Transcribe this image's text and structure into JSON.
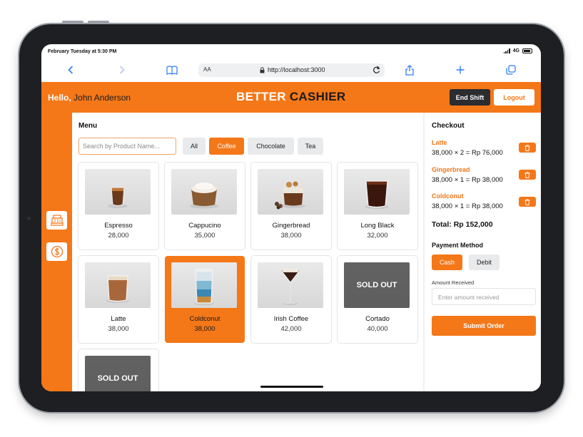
{
  "status_bar": {
    "time": "February Tuesday at 5:30 PM",
    "network": "4G"
  },
  "browser": {
    "url": "http://localhost:3000",
    "text_size_label": "AA"
  },
  "header": {
    "greeting": "Hello,",
    "user_name": "John Anderson",
    "brand_first": "BETTER",
    "brand_second": "CASHIER",
    "end_shift_label": "End Shift",
    "logout_label": "Logout"
  },
  "sidebar": {
    "items": [
      {
        "icon": "cash-register-icon"
      },
      {
        "icon": "dollar-coin-icon"
      }
    ]
  },
  "menu": {
    "title": "Menu",
    "search_placeholder": "Search by Product Name...",
    "filters": [
      {
        "label": "All",
        "active": false
      },
      {
        "label": "Coffee",
        "active": true
      },
      {
        "label": "Chocolate",
        "active": false
      },
      {
        "label": "Tea",
        "active": false
      }
    ],
    "products": [
      {
        "name": "Espresso",
        "price": "28,000",
        "selected": false,
        "sold_out": false
      },
      {
        "name": "Cappucino",
        "price": "35,000",
        "selected": false,
        "sold_out": false
      },
      {
        "name": "Gingerbread",
        "price": "38,000",
        "selected": false,
        "sold_out": false
      },
      {
        "name": "Long Black",
        "price": "32,000",
        "selected": false,
        "sold_out": false
      },
      {
        "name": "Latte",
        "price": "38,000",
        "selected": false,
        "sold_out": false
      },
      {
        "name": "Coldconut",
        "price": "38,000",
        "selected": true,
        "sold_out": false
      },
      {
        "name": "Irish Coffee",
        "price": "42,000",
        "selected": false,
        "sold_out": false
      },
      {
        "name": "Cortado",
        "price": "40,000",
        "selected": false,
        "sold_out": true,
        "sold_out_label": "SOLD OUT"
      },
      {
        "name": "",
        "price": "",
        "selected": false,
        "sold_out": true,
        "sold_out_label": "SOLD OUT"
      }
    ]
  },
  "checkout": {
    "title": "Checkout",
    "items": [
      {
        "name": "Latte",
        "line": "38,000 × 2 = Rp 76,000"
      },
      {
        "name": "Gingerbread",
        "line": "38,000 × 1 = Rp 38,000"
      },
      {
        "name": "Coldconut",
        "line": "38,000 × 1 = Rp 38,000"
      }
    ],
    "total": "Total: Rp 152,000",
    "payment_method_title": "Payment Method",
    "payment_methods": [
      {
        "label": "Cash",
        "active": true
      },
      {
        "label": "Debit",
        "active": false
      }
    ],
    "amount_label": "Amount Received",
    "amount_placeholder": "Enter amount received",
    "submit_label": "Submit Order"
  },
  "colors": {
    "accent": "#f47718",
    "dark": "#2b2d31",
    "ios_blue": "#2f7cf6"
  }
}
